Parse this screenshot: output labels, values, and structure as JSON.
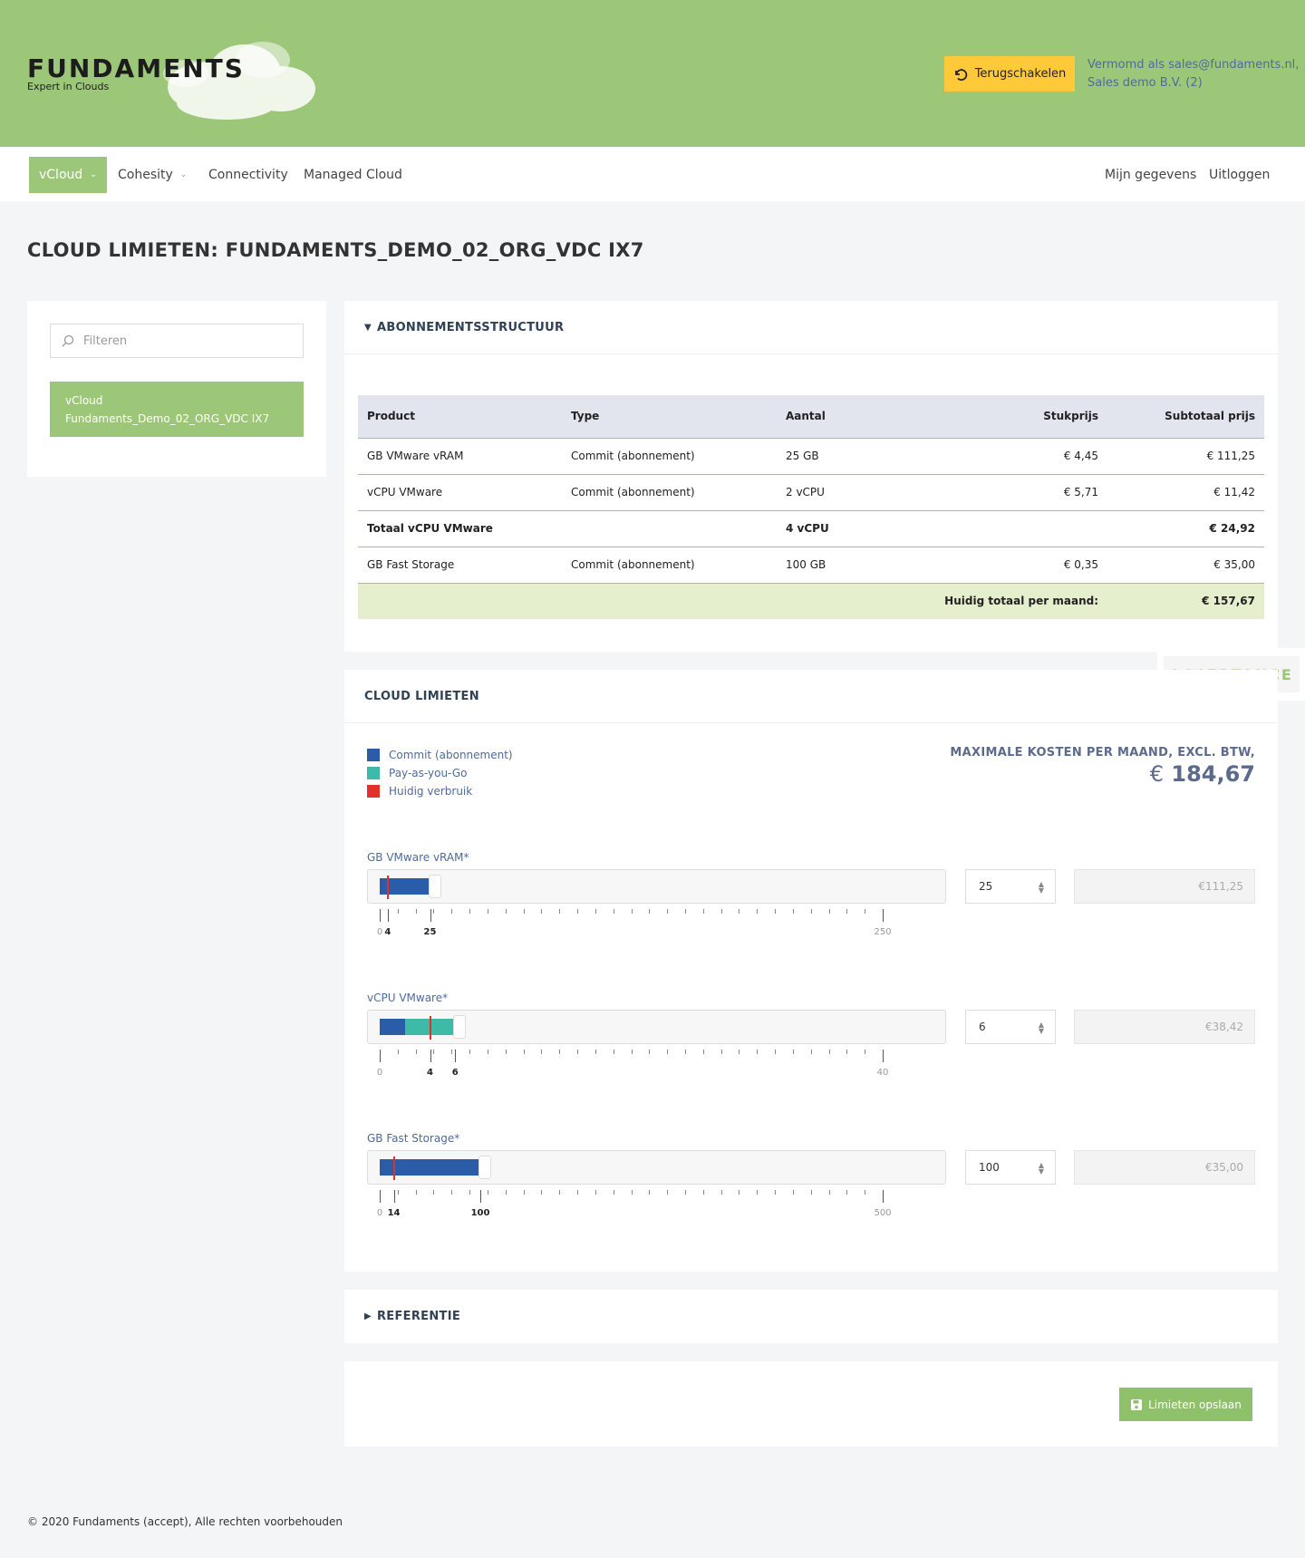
{
  "brand": {
    "name": "FUNDAMENTS",
    "tagline": "Expert in Clouds"
  },
  "header": {
    "switch_label": "Terugschakelen",
    "impersonate_line1": "Vermomd als sales@fundaments.nl,",
    "impersonate_line2": "Sales demo B.V. (2)"
  },
  "nav": {
    "items": [
      {
        "label": "vCloud"
      },
      {
        "label": "Cohesity"
      },
      {
        "label": "Connectivity"
      },
      {
        "label": "Managed Cloud"
      }
    ],
    "right": [
      {
        "label": "Mijn gegevens"
      },
      {
        "label": "Uitloggen"
      }
    ]
  },
  "page_title": "CLOUD LIMIETEN: FUNDAMENTS_DEMO_02_ORG_VDC IX7",
  "sidebar": {
    "filter_placeholder": "Filteren",
    "item_label": "vCloud Fundaments_Demo_02_ORG_VDC IX7"
  },
  "subscription": {
    "title": "ABONNEMENTSSTRUCTUUR",
    "headers": [
      "Product",
      "Type",
      "Aantal",
      "Stukprijs",
      "Subtotaal prijs"
    ],
    "rows": [
      [
        "GB VMware vRAM",
        "Commit (abonnement)",
        "25 GB",
        "€ 4,45",
        "€ 111,25"
      ],
      [
        "vCPU VMware",
        "Commit (abonnement)",
        "2 vCPU",
        "€ 5,71",
        "€ 11,42"
      ],
      [
        "Totaal vCPU VMware",
        "",
        "4 vCPU",
        "",
        "€ 24,92"
      ],
      [
        "GB Fast Storage",
        "Commit (abonnement)",
        "100 GB",
        "€ 0,35",
        "€ 35,00"
      ]
    ],
    "total_label": "Huidig totaal per maand:",
    "total_value": "€ 157,67"
  },
  "env_badge": "ACCEPTANCE",
  "limits": {
    "title": "CLOUD LIMIETEN",
    "legend": [
      {
        "label": "Commit (abonnement)",
        "color": "#2a5ca8"
      },
      {
        "label": "Pay-as-you-Go",
        "color": "#3dbaa8"
      },
      {
        "label": "Huidig verbruik",
        "color": "#e0322a"
      }
    ],
    "max_cost_label": "MAXIMALE KOSTEN PER MAAND, EXCL. BTW,",
    "max_cost_currency": "€",
    "max_cost_value": "184,67",
    "sliders": [
      {
        "label": "GB VMware vRAM*",
        "max": 250,
        "commit": 25,
        "payg": 0,
        "usage": 4,
        "value": "25",
        "price": "€111,25",
        "tick_labels": [
          "0",
          "4",
          "25",
          "250"
        ]
      },
      {
        "label": "vCPU VMware*",
        "max": 40,
        "commit": 2,
        "payg": 4,
        "usage": 4,
        "value": "6",
        "price": "€38,42",
        "tick_labels": [
          "0",
          "4",
          "6",
          "40"
        ]
      },
      {
        "label": "GB Fast Storage*",
        "max": 500,
        "commit": 100,
        "payg": 0,
        "usage": 14,
        "value": "100",
        "price": "€35,00",
        "tick_labels": [
          "0",
          "14",
          "100",
          "500"
        ]
      }
    ]
  },
  "reference": {
    "title": "REFERENTIE"
  },
  "save_label": "Limieten opslaan",
  "footer": "© 2020 Fundaments (accept), Alle rechten voorbehouden"
}
